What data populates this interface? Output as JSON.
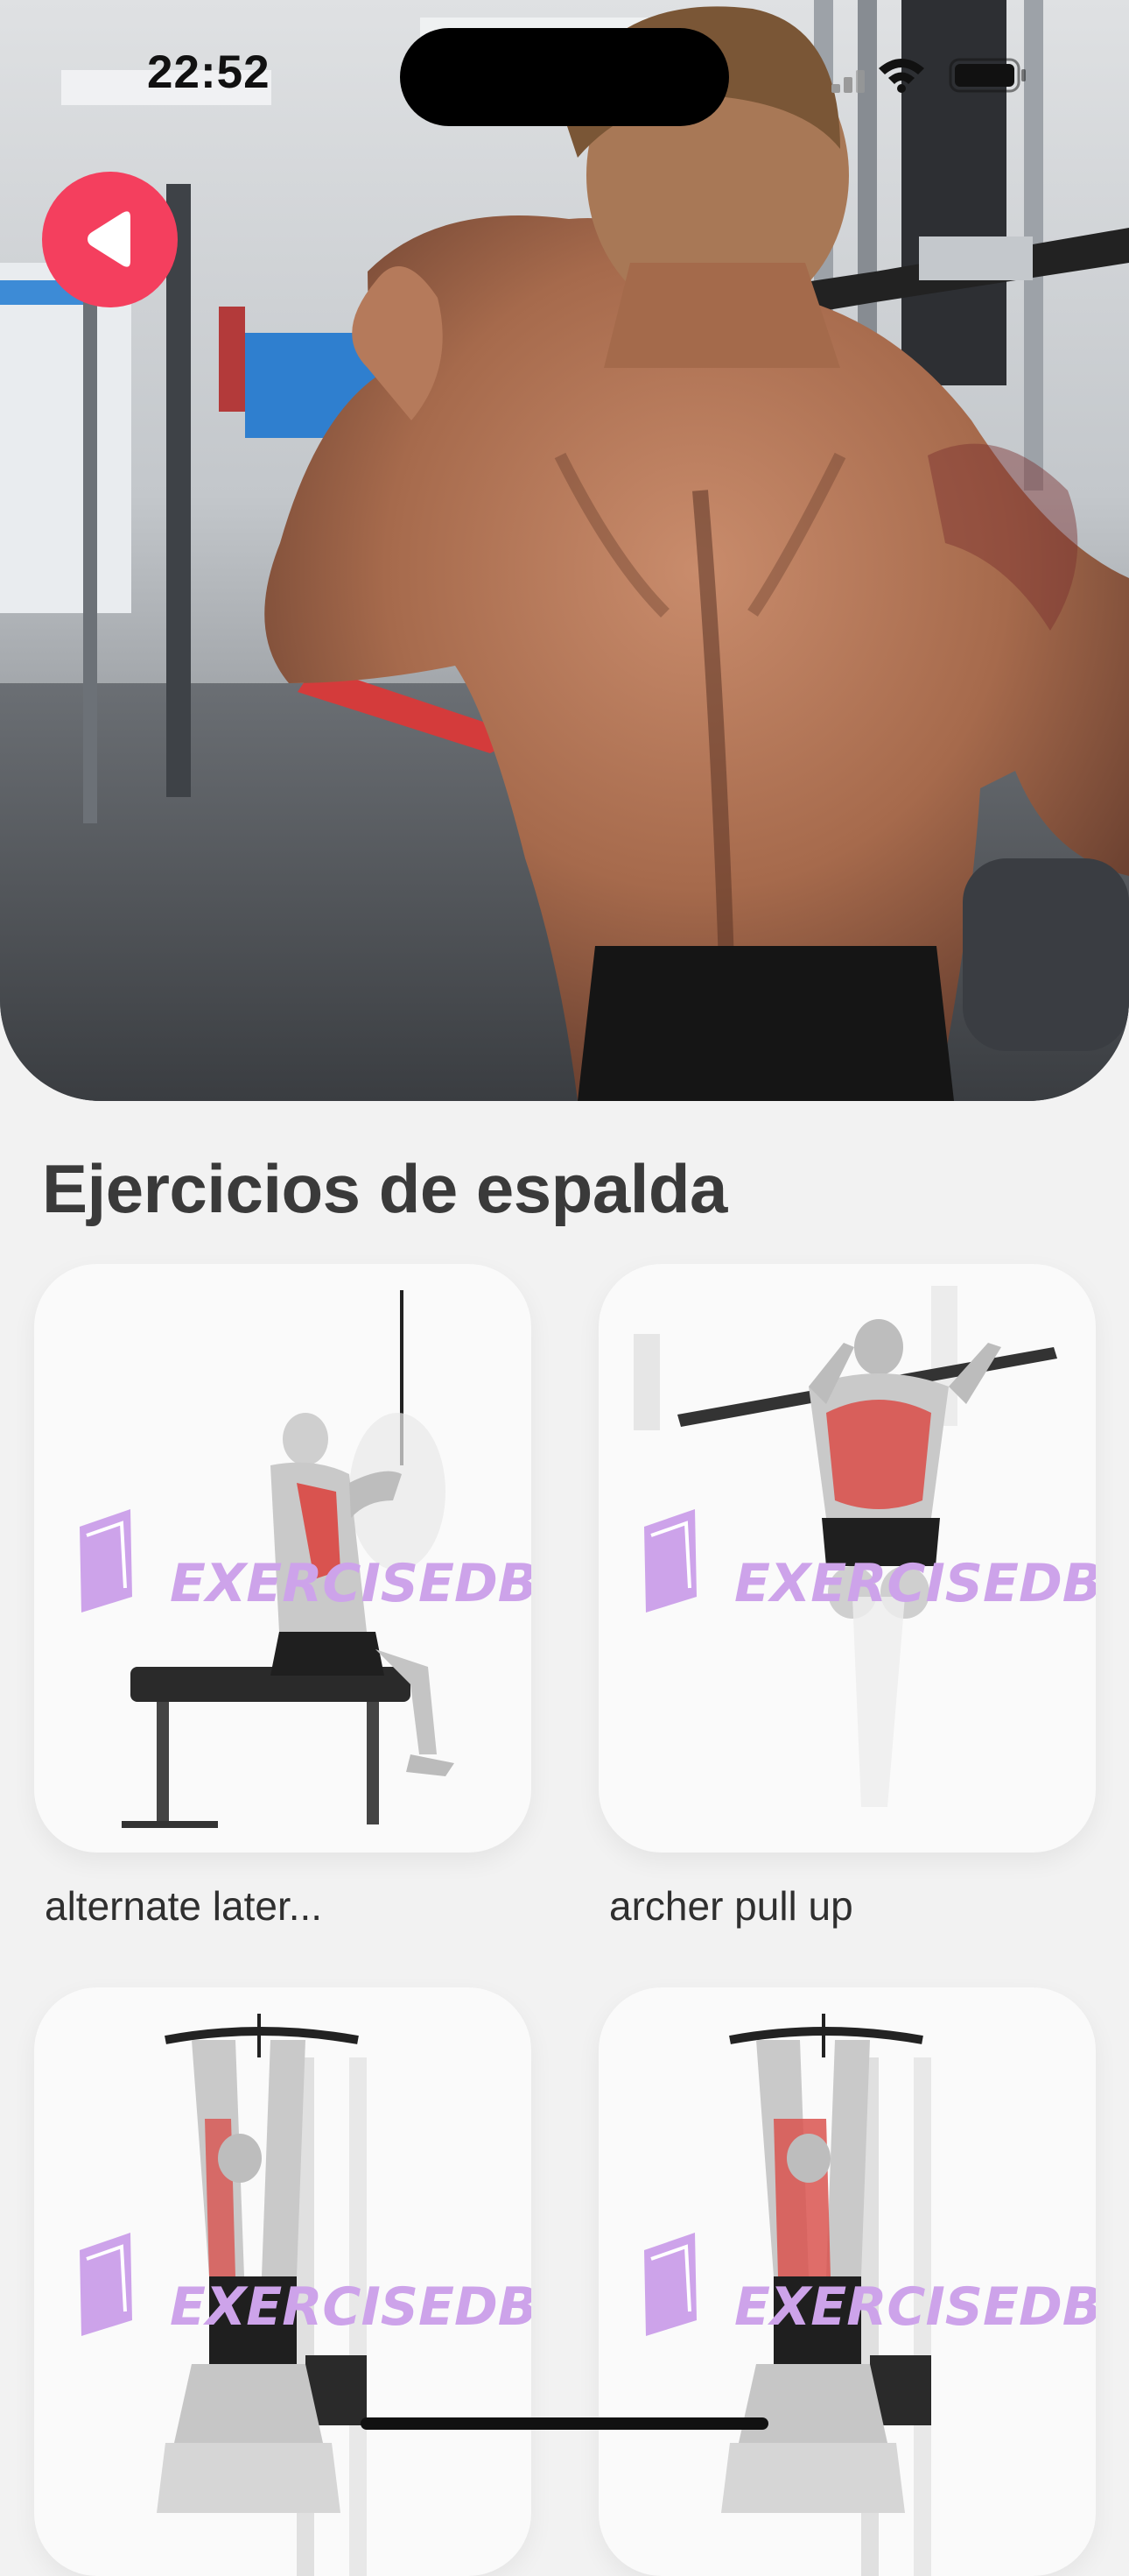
{
  "status_bar": {
    "time": "22:52"
  },
  "header": {
    "back_icon": "play-left-icon",
    "accent_color": "#f43f5e"
  },
  "section": {
    "title": "Ejercicios de espalda"
  },
  "exercises": [
    {
      "name": "alternate later...",
      "watermark": "EXERCISEDB"
    },
    {
      "name": "archer pull up",
      "watermark": "EXERCISEDB"
    },
    {
      "name": "",
      "watermark": "EXERCISEDB"
    },
    {
      "name": "",
      "watermark": "EXERCISEDB"
    }
  ]
}
